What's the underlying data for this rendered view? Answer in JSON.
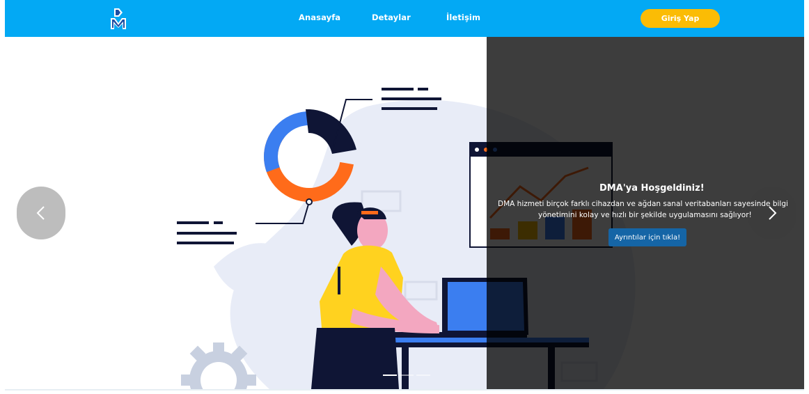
{
  "navbar": {
    "logo_icon": "dma-logo",
    "links": [
      {
        "label": "Anasayfa"
      },
      {
        "label": "Detaylar"
      },
      {
        "label": "İletişim"
      }
    ],
    "login_label": "Giriş Yap",
    "background_color": "#03a9f4",
    "login_color": "#fbbc05"
  },
  "carousel": {
    "prev_icon": "chevron-left-icon",
    "next_icon": "chevron-right-icon",
    "caption": {
      "title": "DMA'ya Hoşgeldiniz!",
      "text_line1": "DMA hizmeti birçok farklı cihazdan ve ağdan sanal veritabanları sayesinde bilgi",
      "text_line2": "yönetimini kolay ve hızlı bir şekilde uygulamasını sağlıyor!",
      "button_label": "Ayrıntılar için tıkla!",
      "button_color": "#1565a6"
    },
    "indicator_count": 3,
    "active_indicator": 1
  }
}
